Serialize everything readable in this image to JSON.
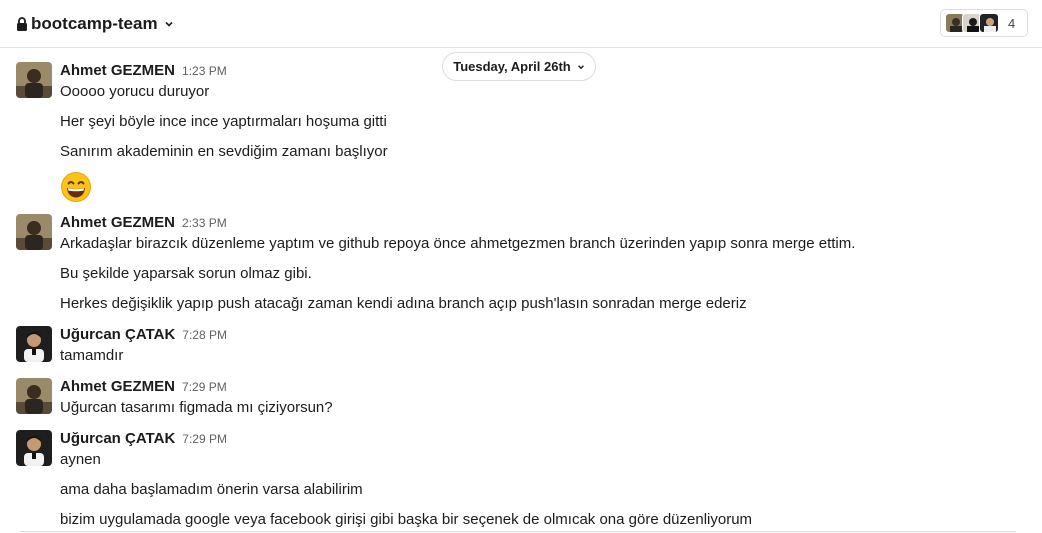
{
  "header": {
    "channel_name": "bootcamp-team",
    "member_count": "4"
  },
  "date_divider": {
    "label": "Tuesday, April 26th"
  },
  "messages": [
    {
      "sender": "Ahmet GEZMEN",
      "time": "1:23 PM",
      "lines": [
        "Ooooo yorucu duruyor",
        "Her şeyi böyle ince ince yaptırmaları hoşuma gitti",
        "Sanırım akademinin en sevdiğim zamanı başlıyor"
      ],
      "emoji": "grinning-face-emoji"
    },
    {
      "sender": "Ahmet GEZMEN",
      "time": "2:33 PM",
      "lines": [
        "Arkadaşlar birazcık düzenleme yaptım ve github repoya önce ahmetgezmen branch üzerinden yapıp sonra merge ettim.",
        "Bu şekilde yaparsak sorun olmaz gibi.",
        "Herkes değişiklik yapıp push atacağı zaman kendi adına branch açıp push'lasın sonradan merge ederiz"
      ]
    },
    {
      "sender": "Uğurcan ÇATAK",
      "time": "7:28 PM",
      "lines": [
        "tamamdır"
      ]
    },
    {
      "sender": "Ahmet GEZMEN",
      "time": "7:29 PM",
      "lines": [
        "Uğurcan tasarımı figmada mı çiziyorsun?"
      ]
    },
    {
      "sender": "Uğurcan ÇATAK",
      "time": "7:29 PM",
      "lines": [
        "aynen",
        "ama daha başlamadım önerin varsa alabilirim",
        "bizim uygulamada google veya facebook girişi gibi başka bir seçenek de olmıcak ona göre düzenliyorum"
      ]
    }
  ],
  "colors": {
    "text": "#1d1c1d",
    "muted": "#616061",
    "border": "#dddddd"
  }
}
